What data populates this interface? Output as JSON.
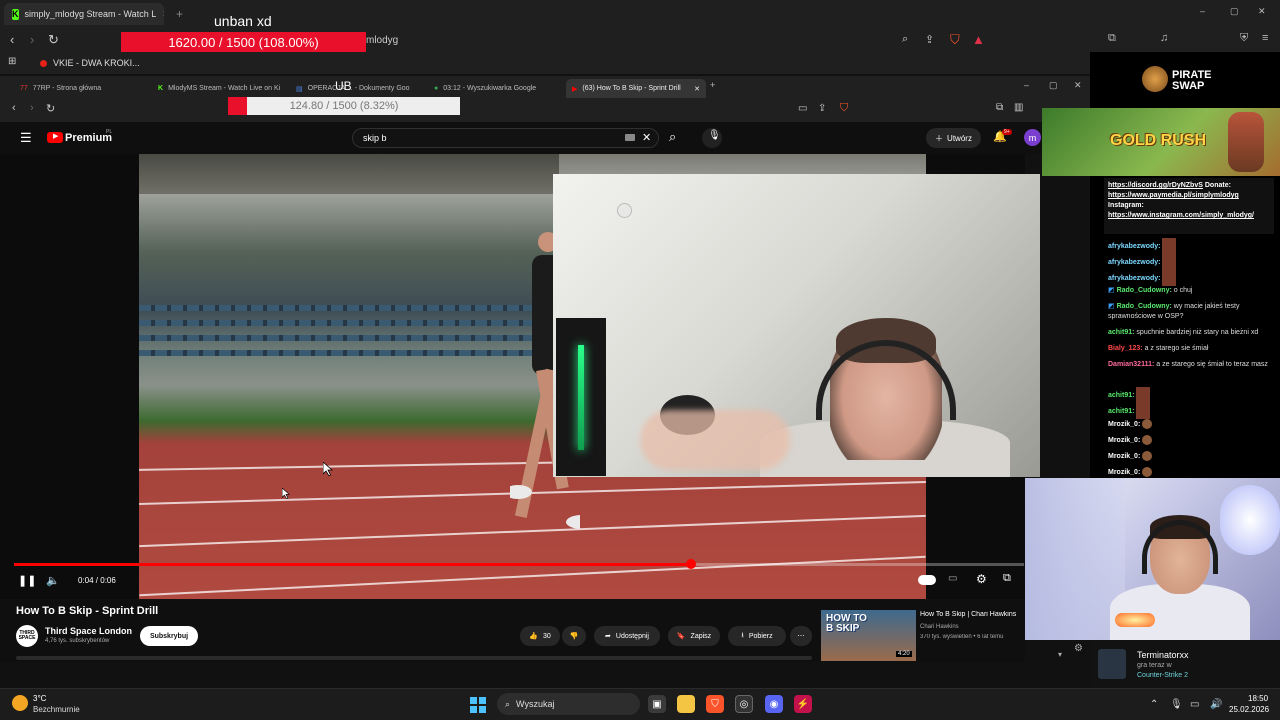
{
  "overlay": {
    "title": "unban xd",
    "goal_text": "1620.00 / 1500 (108.00%)",
    "goal_progress": 1.08,
    "url_fragment": "mlodyg",
    "ub_label": "UB"
  },
  "outer_browser": {
    "active_tab": "simply_mlodyg Stream - Watch L",
    "bookmark": "VKIE - DWA KROKI..."
  },
  "inner_browser": {
    "tabs": [
      {
        "label": "77RP - Strona główna"
      },
      {
        "label": "MlodyMS Stream - Watch Live on Ki"
      },
      {
        "label": "OPERACJA ... - Dokumenty Goo"
      },
      {
        "label": "03:12 - Wyszukiwarka Google"
      },
      {
        "label": "(63) How To B Skip - Sprint Drill"
      }
    ],
    "goal_text": "124.80 / 1500 (8.32%)",
    "goal_progress": 0.0832
  },
  "youtube": {
    "brand": "Premium",
    "brand_suffix": "PL",
    "search_value": "skip b",
    "create_label": "Utwórz",
    "notif_count": "9+",
    "avatar_letter": "m",
    "time": "0:04 / 0:06",
    "progress": 0.67,
    "video_title": "How To B Skip - Sprint Drill",
    "channel_avatar": "THIRD SPACE",
    "channel_name": "Third Space London",
    "channel_subs": "4,76 tys. subskrybentów",
    "subscribe_label": "Subskrybuj",
    "like_count": "30",
    "share_label": "Udostępnij",
    "save_label": "Zapisz",
    "download_label": "Pobierz",
    "recommended": {
      "thumb_text": "HOW TO B SKIP",
      "duration": "4:20",
      "title": "How To B Skip | Chari Hawkins",
      "channel": "Chari Hawkins",
      "meta": "370 tys. wyświetleń • 6 lat temu"
    }
  },
  "stream_overlay": {
    "sponsor": "PIRATE SWAP",
    "banner": "GOLD RUSH",
    "chat_pinned": {
      "discord": "https://discord.gg/rDyNZbvS",
      "donate_label": "Donate:",
      "donate_url": "https://www.paymedia.pl/simplymlodyg",
      "instagram_label": "Instagram:",
      "instagram_url": "https://www.instagram.com/simply_mlodyg/"
    },
    "chat": [
      {
        "user": "afrykabezwody:",
        "msg": "",
        "color": "#7cd8ff"
      },
      {
        "user": "afrykabezwody:",
        "msg": "",
        "color": "#7cd8ff"
      },
      {
        "user": "afrykabezwody:",
        "msg": "",
        "color": "#7cd8ff"
      },
      {
        "user": "Rado_Cudowny:",
        "msg": "o chuj",
        "color": "#59e86e"
      },
      {
        "user": "Rado_Cudowny:",
        "msg": "wy macie jakieś testy sprawnościowe w OSP?",
        "color": "#59e86e"
      },
      {
        "user": "achit91:",
        "msg": "spuchnie bardziej niż stary na bieżni xd",
        "color": "#59e86e"
      },
      {
        "user": "Bialy_123:",
        "msg": "a z starego sie śmiał",
        "color": "#ff4a4a"
      },
      {
        "user": "Damian32111:",
        "msg": "a ze starego się śmiał to teraz masz",
        "color": "#ff6b9b"
      },
      {
        "user": "achit91:",
        "msg": "",
        "color": "#59e86e"
      },
      {
        "user": "achit91:",
        "msg": "",
        "color": "#59e86e"
      },
      {
        "user": "Mrozik_0:",
        "msg": "",
        "color": "#ffffff"
      },
      {
        "user": "Mrozik_0:",
        "msg": "",
        "color": "#ffffff"
      },
      {
        "user": "Mrozik_0:",
        "msg": "",
        "color": "#ffffff"
      },
      {
        "user": "Mrozik_0:",
        "msg": "",
        "color": "#ffffff"
      }
    ],
    "activity": {
      "name": "Terminatorxx",
      "status": "gra teraz w",
      "game": "Counter-Strike 2"
    }
  },
  "taskbar": {
    "temp": "3°C",
    "weather": "Bezchmurnie",
    "search": "Wyszukaj",
    "time": "18:50",
    "date": "25.02.2026"
  }
}
